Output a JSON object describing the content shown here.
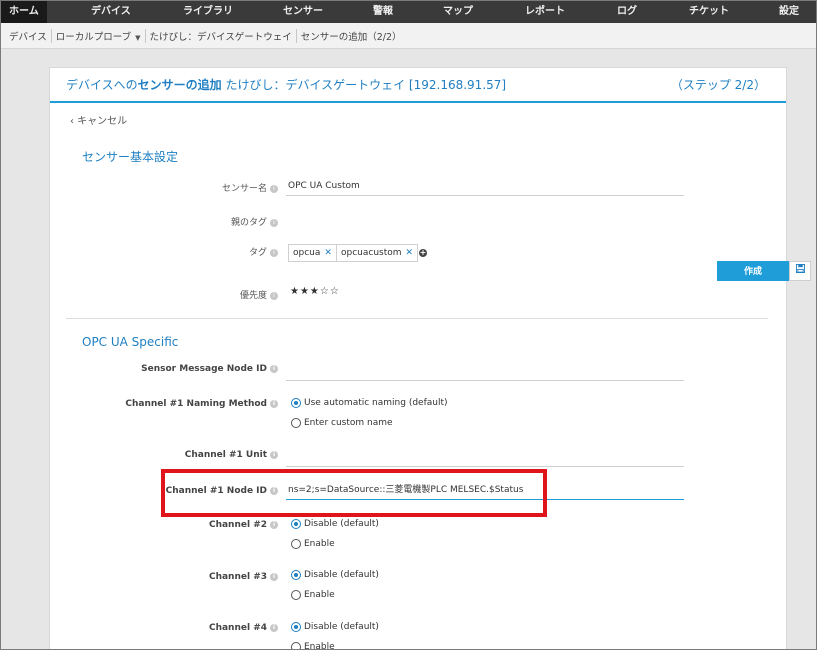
{
  "nav": {
    "items": [
      "ホーム",
      "デバイス",
      "ライブラリ",
      "センサー",
      "警報",
      "マップ",
      "レポート",
      "ログ",
      "チケット",
      "設定"
    ]
  },
  "breadcrumb": {
    "items": [
      "デバイス",
      "ローカルプローブ",
      "たけびし：デバイスゲートウェイ",
      "センサーの追加（2/2）"
    ]
  },
  "panel": {
    "title_prefix": "デバイスへの",
    "title_bold": "センサーの追加",
    "title_suffix": " たけびし：デバイスゲートウェイ [192.168.91.57]",
    "step": "（ステップ 2/2）",
    "cancel": "‹ キャンセル"
  },
  "basic": {
    "section_title": "センサー基本設定",
    "sensor_name_label": "センサー名",
    "sensor_name_value": "OPC UA Custom",
    "parent_tags_label": "親のタグ",
    "tags_label": "タグ",
    "tags": [
      "opcua",
      "opcuacustom"
    ],
    "priority_label": "優先度",
    "priority_stars": "★★★☆☆",
    "priority_value": 3
  },
  "opcua": {
    "section_title": "OPC UA Specific",
    "msg_node_label": "Sensor Message Node ID",
    "msg_node_value": "",
    "naming_label": "Channel #1 Naming Method",
    "naming_opt1": "Use automatic naming (default)",
    "naming_opt2": "Enter custom name",
    "unit_label": "Channel #1 Unit",
    "unit_value": "",
    "node_id_label": "Channel #1 Node ID",
    "node_id_value": "ns=2;s=DataSource::三菱電機製PLC MELSEC.$Status",
    "ch2_label": "Channel #2",
    "ch3_label": "Channel #3",
    "ch4_label": "Channel #4",
    "disable_opt": "Disable (default)",
    "enable_opt": "Enable"
  },
  "actions": {
    "create": "作成",
    "save_icon": "floppy-disk-icon"
  },
  "colors": {
    "accent": "#1f9dd9",
    "title_blue": "#1f7fc2",
    "nav_bg": "#3a3a3a",
    "highlight_red": "#e0141b"
  }
}
